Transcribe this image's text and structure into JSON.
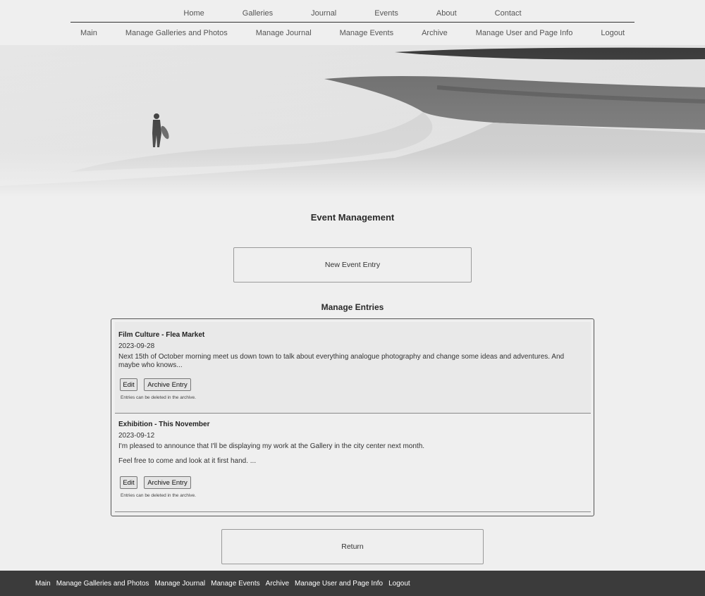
{
  "nav_primary": [
    "Home",
    "Galleries",
    "Journal",
    "Events",
    "About",
    "Contact"
  ],
  "nav_secondary": [
    "Main",
    "Manage Galleries and Photos",
    "Manage Journal",
    "Manage Events",
    "Archive",
    "Manage User and Page Info",
    "Logout"
  ],
  "page_title": "Event Management",
  "new_entry_label": "New Event Entry",
  "section_title": "Manage Entries",
  "entries": [
    {
      "title": "Film Culture - Flea Market",
      "date": "2023-09-28",
      "text": [
        "Next 15th of October morning meet us down town to talk about everything analogue photography and change some ideas and adventures. And maybe who knows..."
      ],
      "edit_label": "Edit",
      "archive_label": "Archive Entry",
      "note": "Entries can be deleted in the archive."
    },
    {
      "title": "Exhibition - This November",
      "date": "2023-09-12",
      "text": [
        "I'm pleased to announce that I'll be displaying my work at the Gallery in the city center next month.",
        "Feel free to come and look at it first hand. ..."
      ],
      "edit_label": "Edit",
      "archive_label": "Archive Entry",
      "note": "Entries can be deleted in the archive."
    }
  ],
  "return_label": "Return",
  "footer_links": [
    "Main",
    "Manage Galleries and Photos",
    "Manage Journal",
    "Manage Events",
    "Archive",
    "Manage User and Page Info",
    "Logout"
  ],
  "colors": {
    "background": "#efefef",
    "footer": "#3b3b3b",
    "text": "#222222"
  }
}
